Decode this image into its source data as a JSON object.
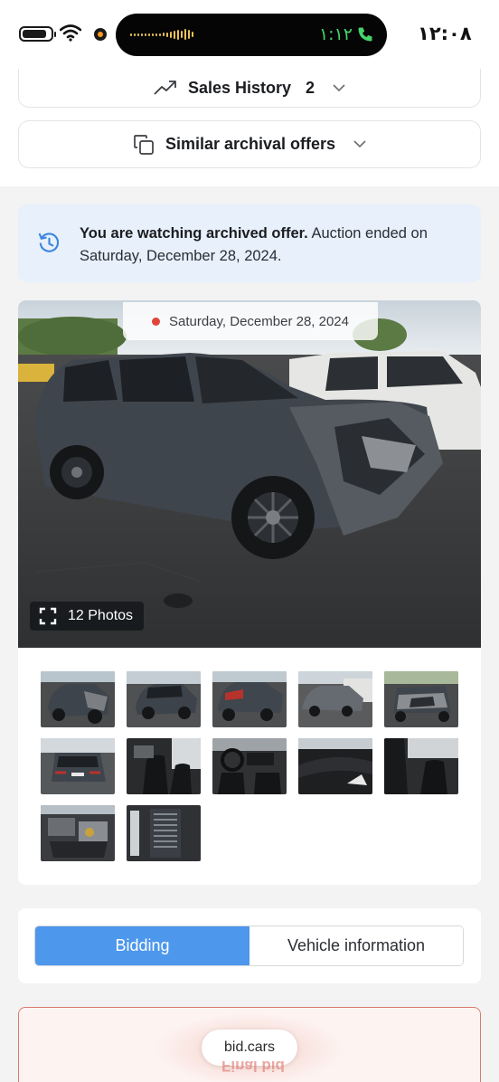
{
  "status_bar": {
    "call_time": "١:١٢",
    "clock": "١٢:٠٨"
  },
  "sales_history": {
    "label": "Sales History",
    "count": "2",
    "icon": "trending-up-icon"
  },
  "similar_offers": {
    "label": "Similar archival offers",
    "icon": "copy-icon"
  },
  "archived_notice": {
    "bold_text": "You are watching archived offer.",
    "text": " Auction ended on Saturday, December 28, 2024.",
    "icon": "history-icon",
    "background": "#e7f0fb"
  },
  "gallery": {
    "date_label": "Saturday, December 28, 2024",
    "photos_label": "12 Photos",
    "thumbnail_count": 12
  },
  "tabs": {
    "items": [
      "Bidding",
      "Vehicle information"
    ],
    "active": "Bidding",
    "active_color": "#4d97ec"
  },
  "final_bid": {
    "watermark": "bid.cars",
    "mirrored_label": "Final bid",
    "border_color": "#d97b6c"
  }
}
